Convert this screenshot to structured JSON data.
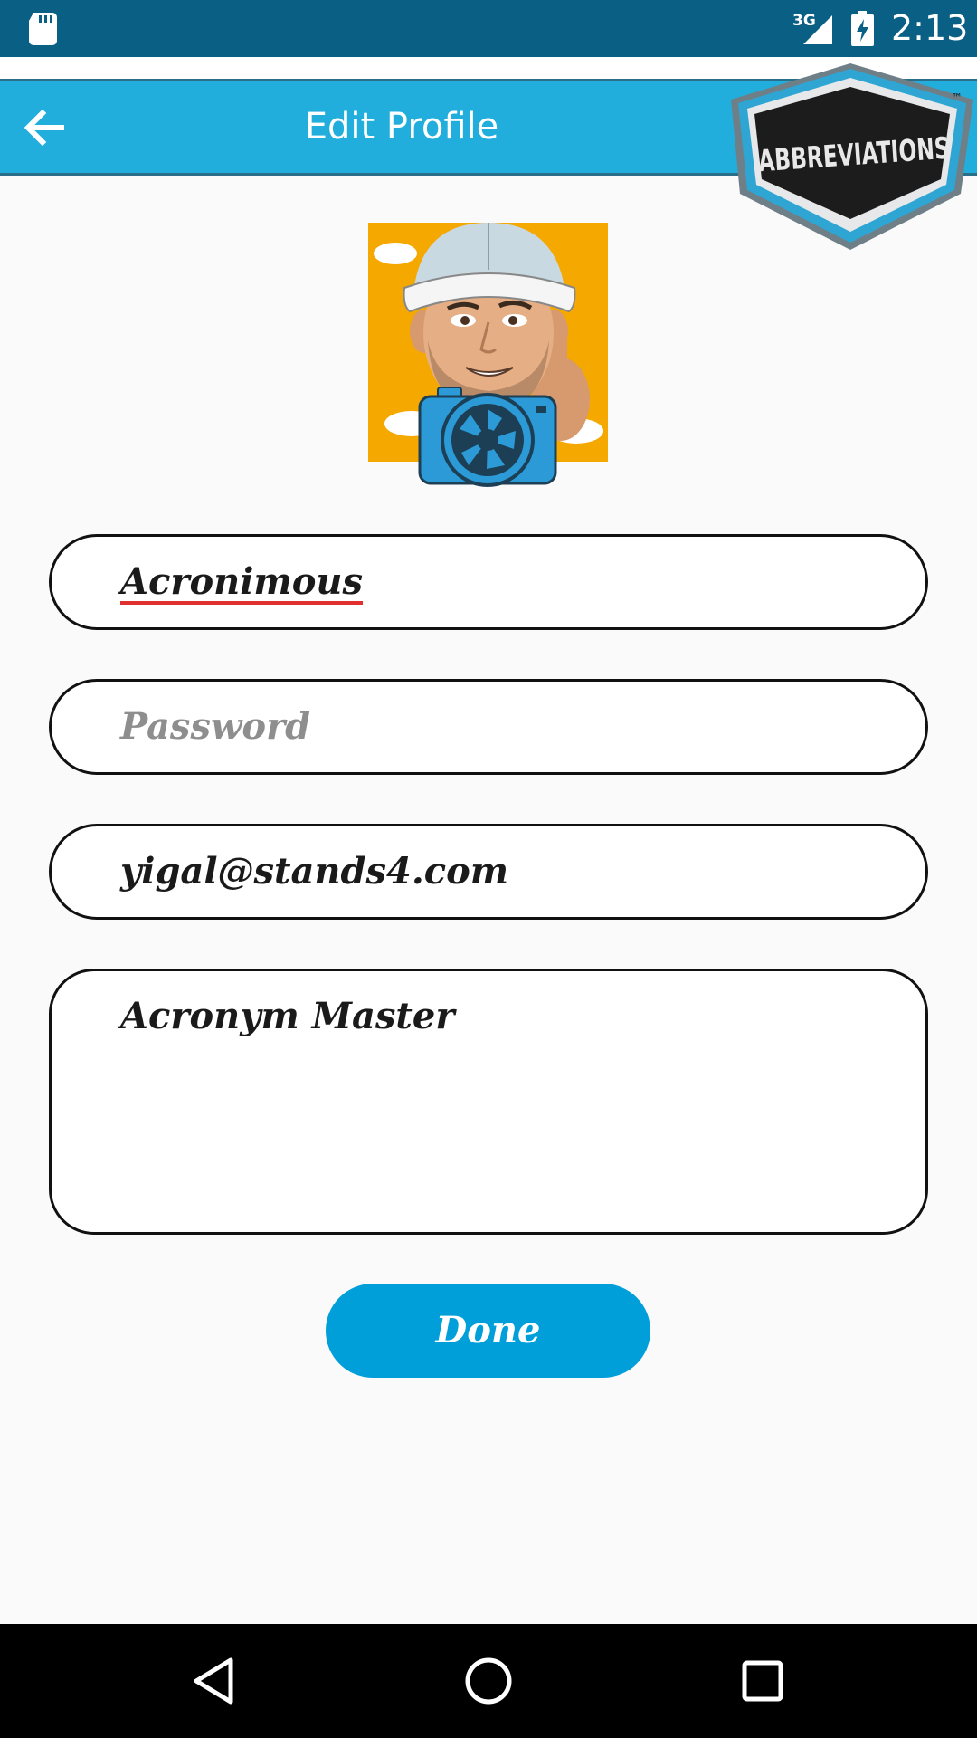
{
  "status": {
    "network": "3G",
    "time": "2:13"
  },
  "toolbar": {
    "title": "Edit Profile",
    "back_icon": "arrow-back-icon"
  },
  "logo": {
    "text": "ABBREVIATIONS",
    "trademark": "™"
  },
  "profile": {
    "avatar_icon": "avatar-cartoon",
    "camera_icon": "camera-icon"
  },
  "form": {
    "username_value": "Acronimous",
    "password_placeholder": "Password",
    "email_value": "yigal@stands4.com",
    "bio_value": "Acronym Master"
  },
  "actions": {
    "done_label": "Done"
  },
  "colors": {
    "status_bar": "#0a5f85",
    "toolbar": "#22aedd",
    "accent": "#009fd9"
  }
}
